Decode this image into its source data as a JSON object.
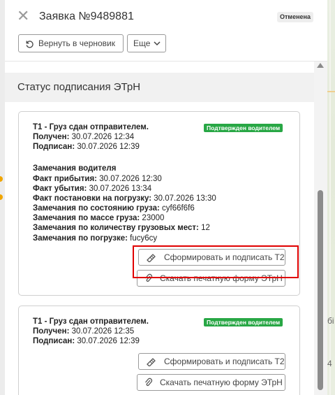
{
  "header": {
    "title": "Заявка №9489881",
    "status_badge": "Отменена",
    "revert_button": "Вернуть в черновик",
    "more_button": "Еще"
  },
  "section": {
    "title": "Статус подписания ЭТрН"
  },
  "cards": [
    {
      "title": "Т1 - Груз сдан отправителем.",
      "badge": "Подтвержден водителем",
      "received_label": "Получен:",
      "received_value": "30.07.2026 12:34",
      "signed_label": "Подписан:",
      "signed_value": "30.07.2026 12:39",
      "remarks_title": "Замечания водителя",
      "remarks": [
        {
          "label": "Факт прибытия:",
          "value": "30.07.2026 12:30"
        },
        {
          "label": "Факт убытия:",
          "value": "30.07.2026 13:34"
        },
        {
          "label": "Факт постановки на погрузку:",
          "value": "30.07.2026 13:30"
        },
        {
          "label": "Замечания по состоянию груза:",
          "value": "cyf66f6f6"
        },
        {
          "label": "Замечания по массе груза:",
          "value": "23000"
        },
        {
          "label": "Замечания по количеству грузовых мест:",
          "value": "12"
        },
        {
          "label": "Замечания по погрузке:",
          "value": "fucy6cy"
        }
      ],
      "sign_button": "Сформировать и подписать Т2",
      "download_button": "Скачать печатную форму ЭТрН"
    },
    {
      "title": "Т1 - Груз сдан отправителем.",
      "badge": "Подтвержден водителем",
      "received_label": "Получен:",
      "received_value": "30.07.2026 12:35",
      "signed_label": "Подписан:",
      "signed_value": "30.07.2026 12:39",
      "sign_button": "Сформировать и подписать Т2",
      "download_button": "Скачать печатную форму ЭТрН"
    }
  ],
  "map": {
    "labels": [
      "бі",
      "4"
    ]
  },
  "colors": {
    "confirmed_badge": "#28a745",
    "highlight": "#e00000"
  },
  "icons": [
    "close-icon",
    "undo-icon",
    "chevron-down-icon",
    "signature-icon",
    "paperclip-icon"
  ]
}
